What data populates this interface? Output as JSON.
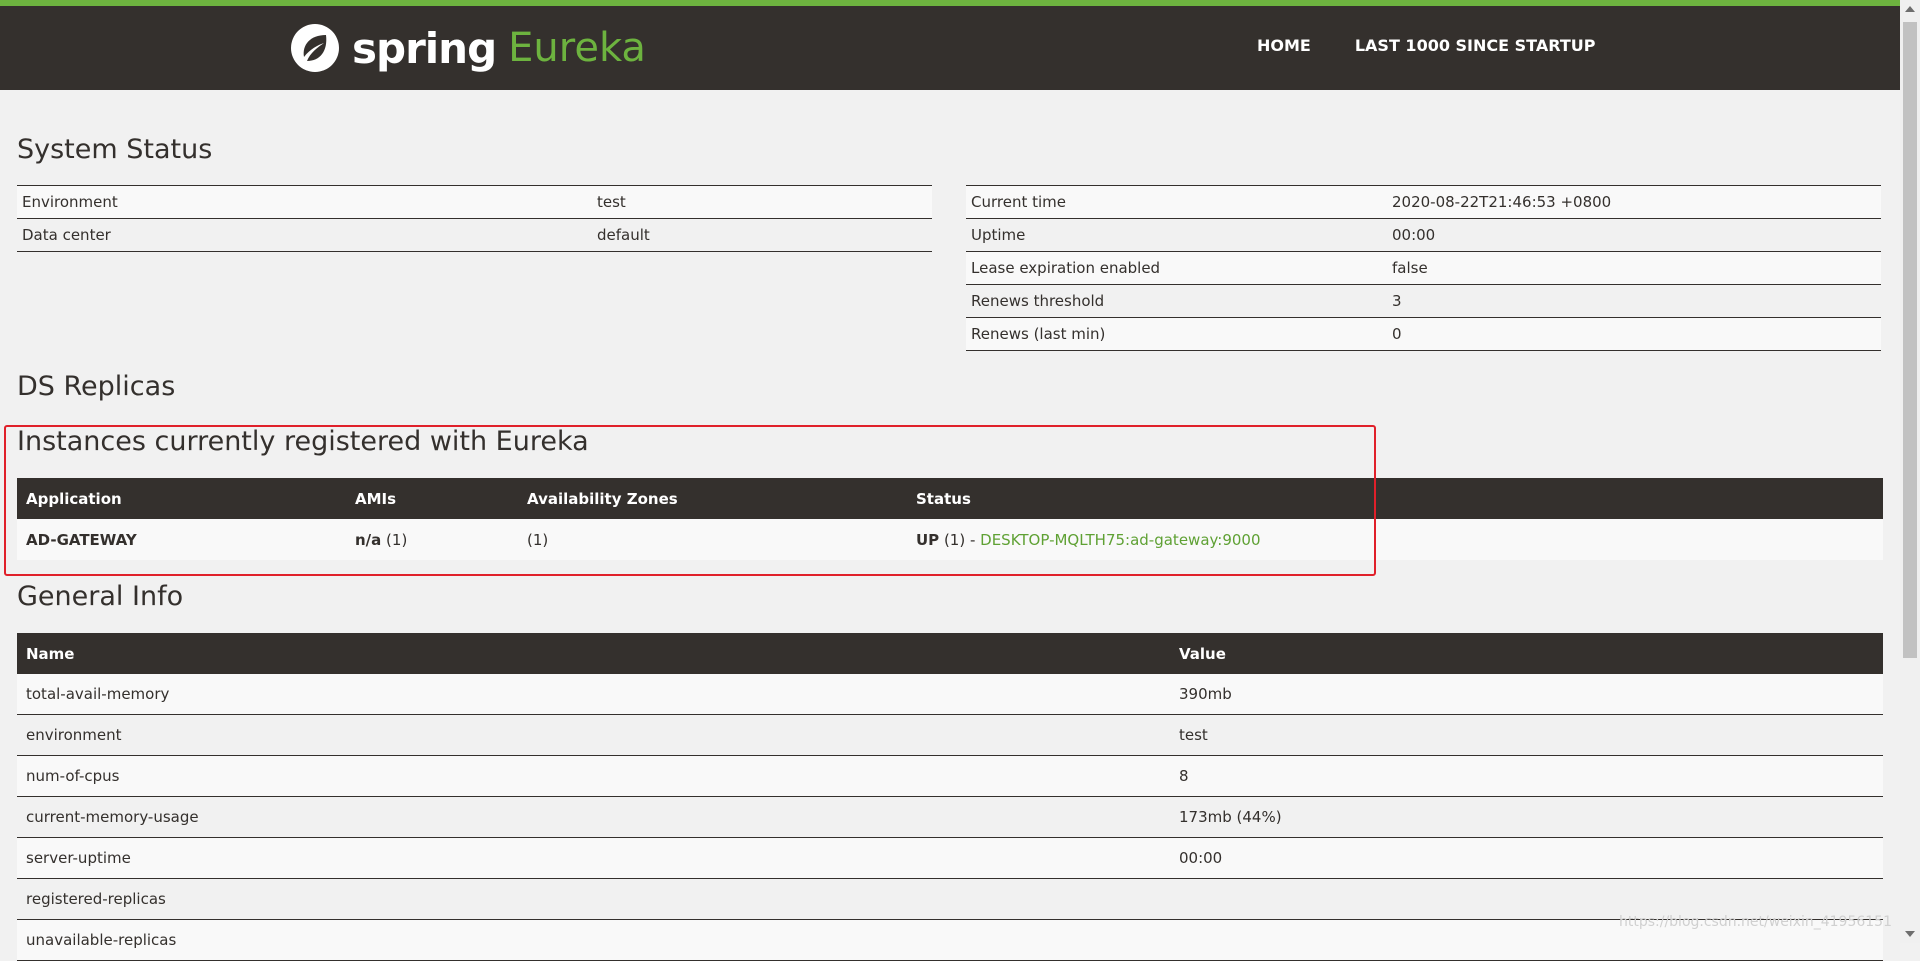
{
  "brand": {
    "word1": "spring",
    "word2": "Eureka"
  },
  "nav": {
    "home": "HOME",
    "last1000": "LAST 1000 SINCE STARTUP"
  },
  "system_status": {
    "title": "System Status",
    "left": [
      {
        "label": "Environment",
        "value": "test"
      },
      {
        "label": "Data center",
        "value": "default"
      }
    ],
    "right": [
      {
        "label": "Current time",
        "value": "2020-08-22T21:46:53 +0800"
      },
      {
        "label": "Uptime",
        "value": "00:00"
      },
      {
        "label": "Lease expiration enabled",
        "value": "false"
      },
      {
        "label": "Renews threshold",
        "value": "3"
      },
      {
        "label": "Renews (last min)",
        "value": "0"
      }
    ]
  },
  "ds_replicas": {
    "title": "DS Replicas"
  },
  "instances": {
    "title": "Instances currently registered with Eureka",
    "headers": [
      "Application",
      "AMIs",
      "Availability Zones",
      "Status"
    ],
    "rows": [
      {
        "application": "AD-GATEWAY",
        "amis_value": "n/a",
        "amis_count": " (1)",
        "zones": "(1)",
        "status": "UP",
        "status_count": " (1) - ",
        "instance_link": "DESKTOP-MQLTH75:ad-gateway:9000"
      }
    ]
  },
  "general_info": {
    "title": "General Info",
    "headers": [
      "Name",
      "Value"
    ],
    "rows": [
      {
        "name": "total-avail-memory",
        "value": "390mb"
      },
      {
        "name": "environment",
        "value": "test"
      },
      {
        "name": "num-of-cpus",
        "value": "8"
      },
      {
        "name": "current-memory-usage",
        "value": "173mb (44%)"
      },
      {
        "name": "server-uptime",
        "value": "00:00"
      },
      {
        "name": "registered-replicas",
        "value": ""
      },
      {
        "name": "unavailable-replicas",
        "value": ""
      }
    ]
  },
  "watermark": "https://blog.csdn.net/weixin_41956151",
  "colors": {
    "brand_green": "#6db33f",
    "dark": "#34302d",
    "highlight_red": "#e0202a"
  }
}
